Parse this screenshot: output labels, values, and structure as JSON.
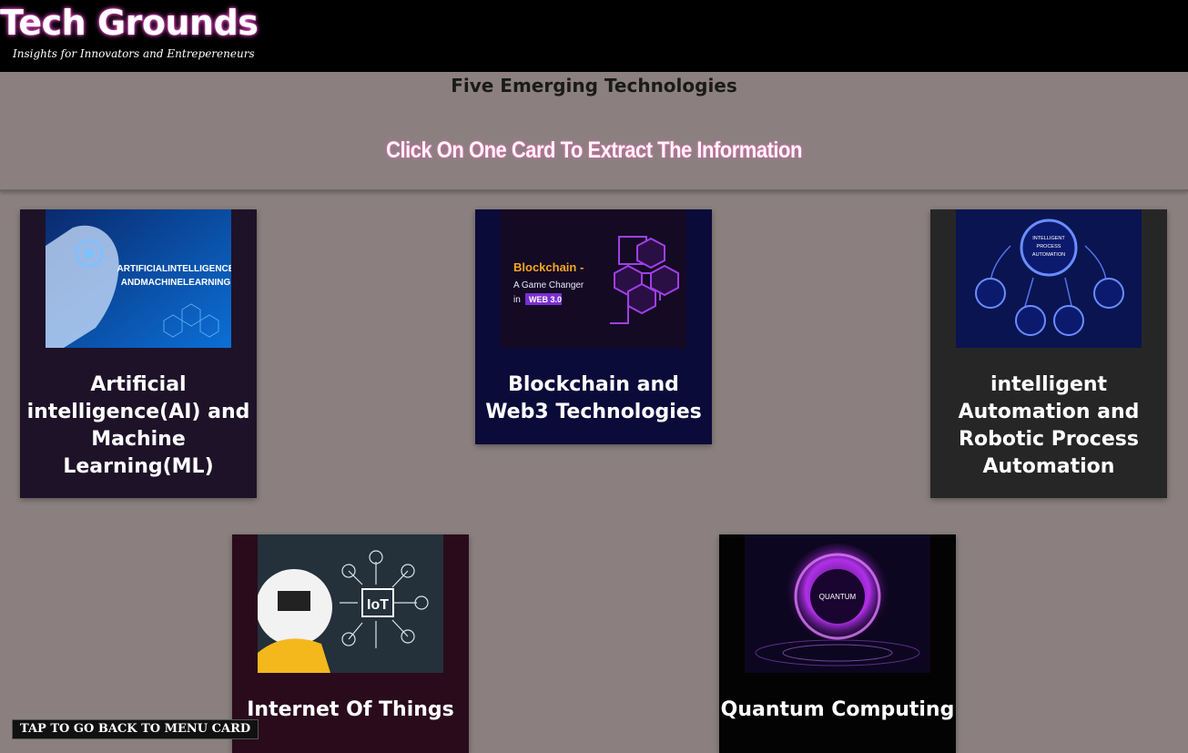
{
  "header": {
    "brand": "Tech Grounds",
    "tagline": "Insights for Innovators and Entrepereneurs"
  },
  "hero": {
    "title": "Five Emerging Technologies",
    "instruction": "Click On One Card To Extract The Information"
  },
  "cards": [
    {
      "label": "Artificial intelligence(AI) and Machine Learning(ML)",
      "image_text": "ARTIFICIAL INTELLIGENCE AND MACHINE LEARNING"
    },
    {
      "label": "Blockchain and Web3 Technologies",
      "image_text": {
        "title": "Blockchain -",
        "sub": "A Game Changer",
        "in": "in",
        "badge": "WEB 3.0"
      }
    },
    {
      "label": "intelligent Automation and Robotic Process Automation",
      "image_text": {
        "center": "INTELLIGENT PROCESS AUTOMATION"
      }
    },
    {
      "label": "Internet Of Things",
      "image_text": "IoT"
    },
    {
      "label": "Quantum Computing",
      "image_text": "QUANTUM"
    }
  ],
  "footer": {
    "back_label": "TAP TO GO BACK TO MENU CARD"
  },
  "colors": {
    "background": "#8b807f",
    "topbar": "#000000",
    "accent_glow": "#ff4fd8"
  }
}
